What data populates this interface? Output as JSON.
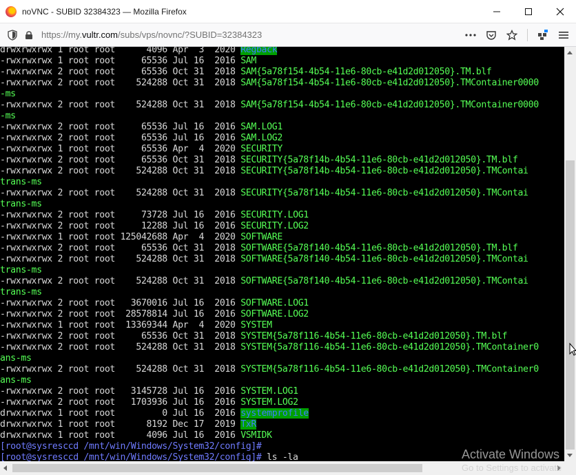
{
  "window": {
    "title": "noVNC - SUBID 32384323 — Mozilla Firefox",
    "minimize_icon": "minimize-icon",
    "maximize_icon": "maximize-icon",
    "close_icon": "close-icon"
  },
  "navbar": {
    "url_prefix": "https://my.",
    "url_host": "vultr.com",
    "url_suffix": "/subs/vps/novnc/?SUBID=32384323",
    "page_actions_icon": "ellipsis-icon",
    "pocket_icon": "pocket-icon",
    "bookmark_icon": "star-icon",
    "extensions_icon": "extensions-icon",
    "menu_icon": "hamburger-menu-icon"
  },
  "terminal": {
    "lines": [
      {
        "perm": "drwxrwxrwx",
        "links": "1",
        "owner": "root",
        "group": "root",
        "size": "4096",
        "month": "Apr",
        "day": " 3",
        "year": "2020",
        "name": "Regback",
        "kind": "dir"
      },
      {
        "perm": "-rwxrwxrwx",
        "links": "1",
        "owner": "root",
        "group": "root",
        "size": "65536",
        "month": "Jul",
        "day": "16",
        "year": "2016",
        "name": "SAM",
        "kind": "file"
      },
      {
        "perm": "-rwxrwxrwx",
        "links": "2",
        "owner": "root",
        "group": "root",
        "size": "65536",
        "month": "Oct",
        "day": "31",
        "year": "2018",
        "name": "SAM{5a78f154-4b54-11e6-80cb-e41d2d012050}.TM.blf",
        "kind": "file"
      },
      {
        "perm": "-rwxrwxrwx",
        "links": "2",
        "owner": "root",
        "group": "root",
        "size": "524288",
        "month": "Oct",
        "day": "31",
        "year": "2018",
        "name": "SAM{5a78f154-4b54-11e6-80cb-e41d2d012050}.TMContainer0000",
        "kind": "file"
      },
      {
        "wrap": "-ms"
      },
      {
        "perm": "-rwxrwxrwx",
        "links": "2",
        "owner": "root",
        "group": "root",
        "size": "524288",
        "month": "Oct",
        "day": "31",
        "year": "2018",
        "name": "SAM{5a78f154-4b54-11e6-80cb-e41d2d012050}.TMContainer0000",
        "kind": "file"
      },
      {
        "wrap": "-ms"
      },
      {
        "perm": "-rwxrwxrwx",
        "links": "2",
        "owner": "root",
        "group": "root",
        "size": "65536",
        "month": "Jul",
        "day": "16",
        "year": "2016",
        "name": "SAM.LOG1",
        "kind": "file"
      },
      {
        "perm": "-rwxrwxrwx",
        "links": "2",
        "owner": "root",
        "group": "root",
        "size": "65536",
        "month": "Jul",
        "day": "16",
        "year": "2016",
        "name": "SAM.LOG2",
        "kind": "file"
      },
      {
        "perm": "-rwxrwxrwx",
        "links": "1",
        "owner": "root",
        "group": "root",
        "size": "65536",
        "month": "Apr",
        "day": " 4",
        "year": "2020",
        "name": "SECURITY",
        "kind": "file"
      },
      {
        "perm": "-rwxrwxrwx",
        "links": "2",
        "owner": "root",
        "group": "root",
        "size": "65536",
        "month": "Oct",
        "day": "31",
        "year": "2018",
        "name": "SECURITY{5a78f14b-4b54-11e6-80cb-e41d2d012050}.TM.blf",
        "kind": "file"
      },
      {
        "perm": "-rwxrwxrwx",
        "links": "2",
        "owner": "root",
        "group": "root",
        "size": "524288",
        "month": "Oct",
        "day": "31",
        "year": "2018",
        "name": "SECURITY{5a78f14b-4b54-11e6-80cb-e41d2d012050}.TMContai",
        "kind": "file"
      },
      {
        "wrap": "trans-ms"
      },
      {
        "perm": "-rwxrwxrwx",
        "links": "2",
        "owner": "root",
        "group": "root",
        "size": "524288",
        "month": "Oct",
        "day": "31",
        "year": "2018",
        "name": "SECURITY{5a78f14b-4b54-11e6-80cb-e41d2d012050}.TMContai",
        "kind": "file"
      },
      {
        "wrap": "trans-ms"
      },
      {
        "perm": "-rwxrwxrwx",
        "links": "2",
        "owner": "root",
        "group": "root",
        "size": "73728",
        "month": "Jul",
        "day": "16",
        "year": "2016",
        "name": "SECURITY.LOG1",
        "kind": "file"
      },
      {
        "perm": "-rwxrwxrwx",
        "links": "2",
        "owner": "root",
        "group": "root",
        "size": "12288",
        "month": "Jul",
        "day": "16",
        "year": "2016",
        "name": "SECURITY.LOG2",
        "kind": "file"
      },
      {
        "perm": "-rwxrwxrwx",
        "links": "1",
        "owner": "root",
        "group": "root",
        "size": "125042688",
        "month": "Apr",
        "day": " 4",
        "year": "2020",
        "name": "SOFTWARE",
        "kind": "file"
      },
      {
        "perm": "-rwxrwxrwx",
        "links": "2",
        "owner": "root",
        "group": "root",
        "size": "65536",
        "month": "Oct",
        "day": "31",
        "year": "2018",
        "name": "SOFTWARE{5a78f140-4b54-11e6-80cb-e41d2d012050}.TM.blf",
        "kind": "file"
      },
      {
        "perm": "-rwxrwxrwx",
        "links": "2",
        "owner": "root",
        "group": "root",
        "size": "524288",
        "month": "Oct",
        "day": "31",
        "year": "2018",
        "name": "SOFTWARE{5a78f140-4b54-11e6-80cb-e41d2d012050}.TMContai",
        "kind": "file"
      },
      {
        "wrap": "trans-ms"
      },
      {
        "perm": "-rwxrwxrwx",
        "links": "2",
        "owner": "root",
        "group": "root",
        "size": "524288",
        "month": "Oct",
        "day": "31",
        "year": "2018",
        "name": "SOFTWARE{5a78f140-4b54-11e6-80cb-e41d2d012050}.TMContai",
        "kind": "file"
      },
      {
        "wrap": "trans-ms"
      },
      {
        "perm": "-rwxrwxrwx",
        "links": "2",
        "owner": "root",
        "group": "root",
        "size": "3670016",
        "month": "Jul",
        "day": "16",
        "year": "2016",
        "name": "SOFTWARE.LOG1",
        "kind": "file"
      },
      {
        "perm": "-rwxrwxrwx",
        "links": "2",
        "owner": "root",
        "group": "root",
        "size": "28578814",
        "month": "Jul",
        "day": "16",
        "year": "2016",
        "name": "SOFTWARE.LOG2",
        "kind": "file"
      },
      {
        "perm": "-rwxrwxrwx",
        "links": "1",
        "owner": "root",
        "group": "root",
        "size": "13369344",
        "month": "Apr",
        "day": " 4",
        "year": "2020",
        "name": "SYSTEM",
        "kind": "file"
      },
      {
        "perm": "-rwxrwxrwx",
        "links": "2",
        "owner": "root",
        "group": "root",
        "size": "65536",
        "month": "Oct",
        "day": "31",
        "year": "2018",
        "name": "SYSTEM{5a78f116-4b54-11e6-80cb-e41d2d012050}.TM.blf",
        "kind": "file"
      },
      {
        "perm": "-rwxrwxrwx",
        "links": "2",
        "owner": "root",
        "group": "root",
        "size": "524288",
        "month": "Oct",
        "day": "31",
        "year": "2018",
        "name": "SYSTEM{5a78f116-4b54-11e6-80cb-e41d2d012050}.TMContainer0",
        "kind": "file"
      },
      {
        "wrap": "ans-ms"
      },
      {
        "perm": "-rwxrwxrwx",
        "links": "2",
        "owner": "root",
        "group": "root",
        "size": "524288",
        "month": "Oct",
        "day": "31",
        "year": "2018",
        "name": "SYSTEM{5a78f116-4b54-11e6-80cb-e41d2d012050}.TMContainer0",
        "kind": "file"
      },
      {
        "wrap": "ans-ms"
      },
      {
        "perm": "-rwxrwxrwx",
        "links": "2",
        "owner": "root",
        "group": "root",
        "size": "3145728",
        "month": "Jul",
        "day": "16",
        "year": "2016",
        "name": "SYSTEM.LOG1",
        "kind": "file"
      },
      {
        "perm": "-rwxrwxrwx",
        "links": "2",
        "owner": "root",
        "group": "root",
        "size": "1703936",
        "month": "Jul",
        "day": "16",
        "year": "2016",
        "name": "SYSTEM.LOG2",
        "kind": "file"
      },
      {
        "perm": "drwxrwxrwx",
        "links": "1",
        "owner": "root",
        "group": "root",
        "size": "0",
        "month": "Jul",
        "day": "16",
        "year": "2016",
        "name": "systemprofile",
        "kind": "dir"
      },
      {
        "perm": "drwxrwxrwx",
        "links": "1",
        "owner": "root",
        "group": "root",
        "size": "8192",
        "month": "Dec",
        "day": "17",
        "year": "2019",
        "name": "TxR",
        "kind": "dir"
      },
      {
        "perm": "drwxrwxrwx",
        "links": "1",
        "owner": "root",
        "group": "root",
        "size": "4096",
        "month": "Jul",
        "day": "16",
        "year": "2016",
        "name": "VSMIDK",
        "kind": "file"
      },
      {
        "prompt": "[root@sysresccd /mnt/win/Windows/System32/config]#",
        "cmd": ""
      },
      {
        "prompt": "[root@sysresccd /mnt/win/Windows/System32/config]#",
        "cmd": " ls -la",
        "cursor": true
      }
    ]
  },
  "watermark": {
    "line1": "Activate Windows",
    "line2": "Go to Settings to activate"
  },
  "colors": {
    "terminal_bg": "#000000",
    "file_green": "#55ff55",
    "dir_highlight": "#00a000",
    "prompt_blue": "#6f7bff"
  }
}
